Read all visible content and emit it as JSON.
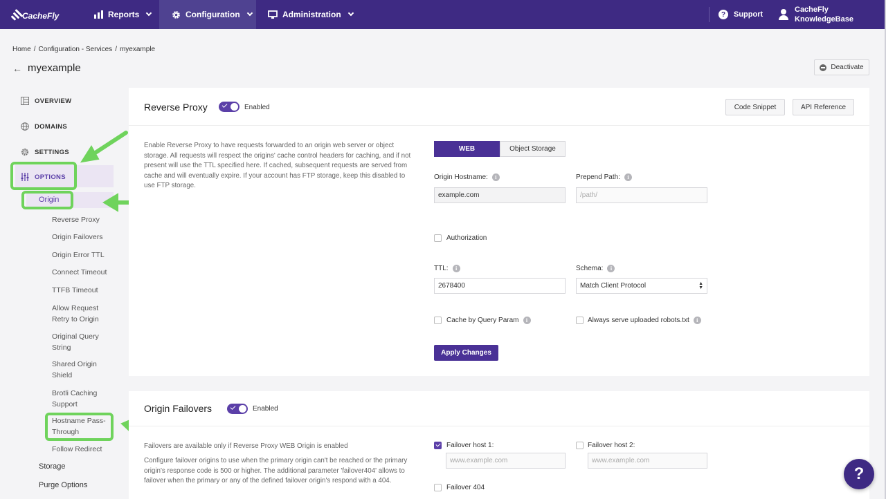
{
  "brand": {
    "name": "CacheFly"
  },
  "nav": {
    "reports": "Reports",
    "configuration": "Configuration",
    "administration": "Administration",
    "support": "Support",
    "user_line1": "CacheFly",
    "user_line2": "KnowledgeBase"
  },
  "breadcrumb": [
    "Home",
    "/",
    "Configuration - Services",
    "/",
    "myexample"
  ],
  "page": {
    "title": "myexample",
    "deactivate": "Deactivate"
  },
  "sidebar": {
    "overview": "OVERVIEW",
    "domains": "DOMAINS",
    "settings": "SETTINGS",
    "options": "OPTIONS",
    "origin": "Origin",
    "sub_items": [
      "Reverse Proxy",
      "Origin Failovers",
      "Origin Error TTL",
      "Connect Timeout",
      "TTFB Timeout",
      "Allow Request Retry to Origin",
      "Original Query String",
      "Shared Origin Shield",
      "Brotli Caching Support",
      "Hostname Pass-Through",
      "Follow Redirect"
    ],
    "storage": "Storage",
    "purge_options": "Purge Options"
  },
  "reverse_proxy": {
    "title": "Reverse Proxy",
    "enabled": "Enabled",
    "code_snippet": "Code Snippet",
    "api_reference": "API Reference",
    "description": "Enable Reverse Proxy to have requests forwarded to an origin web server or object storage. All requests will respect the origins' cache control headers for caching, and if not present will use the TTL specified here. If cached, subsequent requests are served from cache and will eventually expire. If your account has FTP storage, keep this disabled to use FTP storage.",
    "tab_web": "WEB",
    "tab_object_storage": "Object Storage",
    "origin_hostname_label": "Origin Hostname:",
    "origin_hostname_value": "example.com",
    "prepend_path_label": "Prepend Path:",
    "prepend_path_placeholder": "/path/",
    "authorization": "Authorization",
    "ttl_label": "TTL:",
    "ttl_value": "2678400",
    "schema_label": "Schema:",
    "schema_value": "Match Client Protocol",
    "cache_by_query": "Cache by Query Param",
    "robots": "Always serve uploaded robots.txt",
    "apply": "Apply Changes"
  },
  "origin_failovers": {
    "title": "Origin Failovers",
    "enabled": "Enabled",
    "note": "Failovers are available only if Reverse Proxy WEB Origin is enabled",
    "description": "Configure failover origins to use when the primary origin can't be reached or the primary origin's response code is 500 or higher. The additional parameter 'failover404' allows to failover when the primary or any of the defined failover origin's respond with a 404.",
    "host1_label": "Failover host 1:",
    "host1_placeholder": "www.example.com",
    "host2_label": "Failover host 2:",
    "host2_placeholder": "www.example.com",
    "failover404": "Failover 404"
  },
  "help_fab": "?",
  "colors": {
    "brand": "#3e2a83",
    "accent": "#5b3fa8",
    "highlight": "#6fd35c"
  }
}
